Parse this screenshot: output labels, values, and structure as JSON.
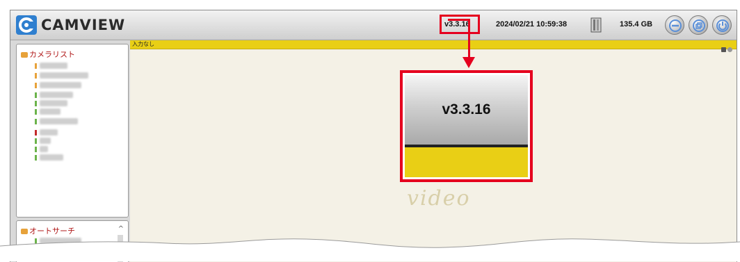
{
  "app": {
    "brand": "CAMVIEW",
    "version": "v3.3.16",
    "datetime": "2024/02/21 10:59:38",
    "disk_free": "135.4 GB"
  },
  "camera_list": {
    "title": "カメラリスト"
  },
  "auto_search": {
    "title": "オートサーチ",
    "scroll_indicator": "^"
  },
  "main": {
    "status_text": "入力なし",
    "watermark": "video"
  },
  "callout": {
    "version": "v3.3.16"
  },
  "colors": {
    "highlight_red": "#e5001e",
    "status_yellow": "#e9cf15"
  }
}
